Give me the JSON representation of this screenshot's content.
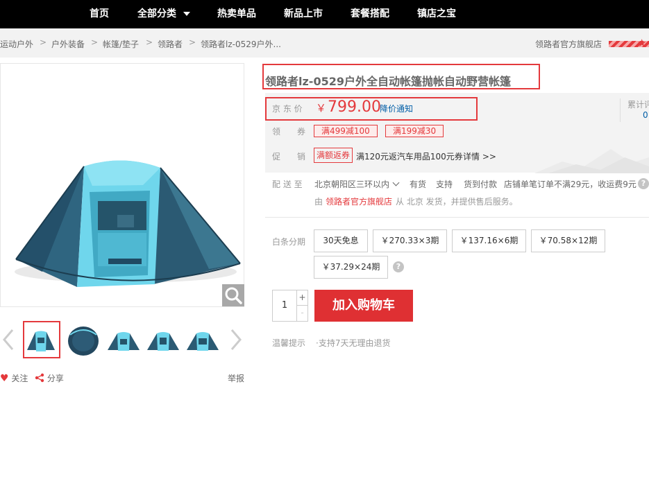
{
  "nav": {
    "items": [
      "首页",
      "全部分类",
      "热卖单品",
      "新品上市",
      "套餐搭配",
      "镇店之宝"
    ]
  },
  "breadcrumb": {
    "items": [
      "运动户外",
      "户外装备",
      "帐篷/垫子",
      "领路者",
      "领路者lz-0529户外..."
    ],
    "separator": ">"
  },
  "shop": {
    "name": "领路者官方旗舰店"
  },
  "gallery": {
    "thumb_count": 5,
    "selected_index": 0,
    "follow_label": "关注",
    "share_label": "分享",
    "report_label": "举报"
  },
  "product": {
    "title": "领路者lz-0529户外全自动帐篷抛帐自动野营帐篷",
    "price_label": "京 东 价",
    "currency": "￥",
    "price": "799.00",
    "price_alert": "降价通知",
    "reviews_label": "累计评",
    "reviews_count": "0",
    "coupon_label": "领　　券",
    "coupons": [
      "满499减100",
      "满199减30"
    ],
    "promo_label": "促　　销",
    "promo_tag": "满额返券",
    "promo_text": "满120元返汽车用品100元券",
    "promo_detail": "详情 >>",
    "delivery_label": "配 送 至",
    "delivery_area": "北京朝阳区三环以内",
    "stock": "有货",
    "support": "支持",
    "cod": "货到付款",
    "shipping_note": "店铺单笔订单不满29元，收运费9元",
    "fulfil_prefix": "由",
    "fulfil_shop": "领路者官方旗舰店",
    "fulfil_suffix": "从 北京 发货，并提供售后服务。",
    "installment_label": "白条分期",
    "installments": [
      "30天免息",
      "￥270.33×3期",
      "￥137.16×6期",
      "￥70.58×12期",
      "￥37.29×24期"
    ],
    "quantity": "1",
    "add_to_cart": "加入购物车",
    "tips_label": "温馨提示",
    "tips_text": "·支持7天无理由退货"
  },
  "colors": {
    "accent": "#e4393c",
    "nav_bg": "#000000",
    "link": "#005ea7",
    "tent_light": "#5fd3ea",
    "tent_dark": "#2b5a73"
  }
}
